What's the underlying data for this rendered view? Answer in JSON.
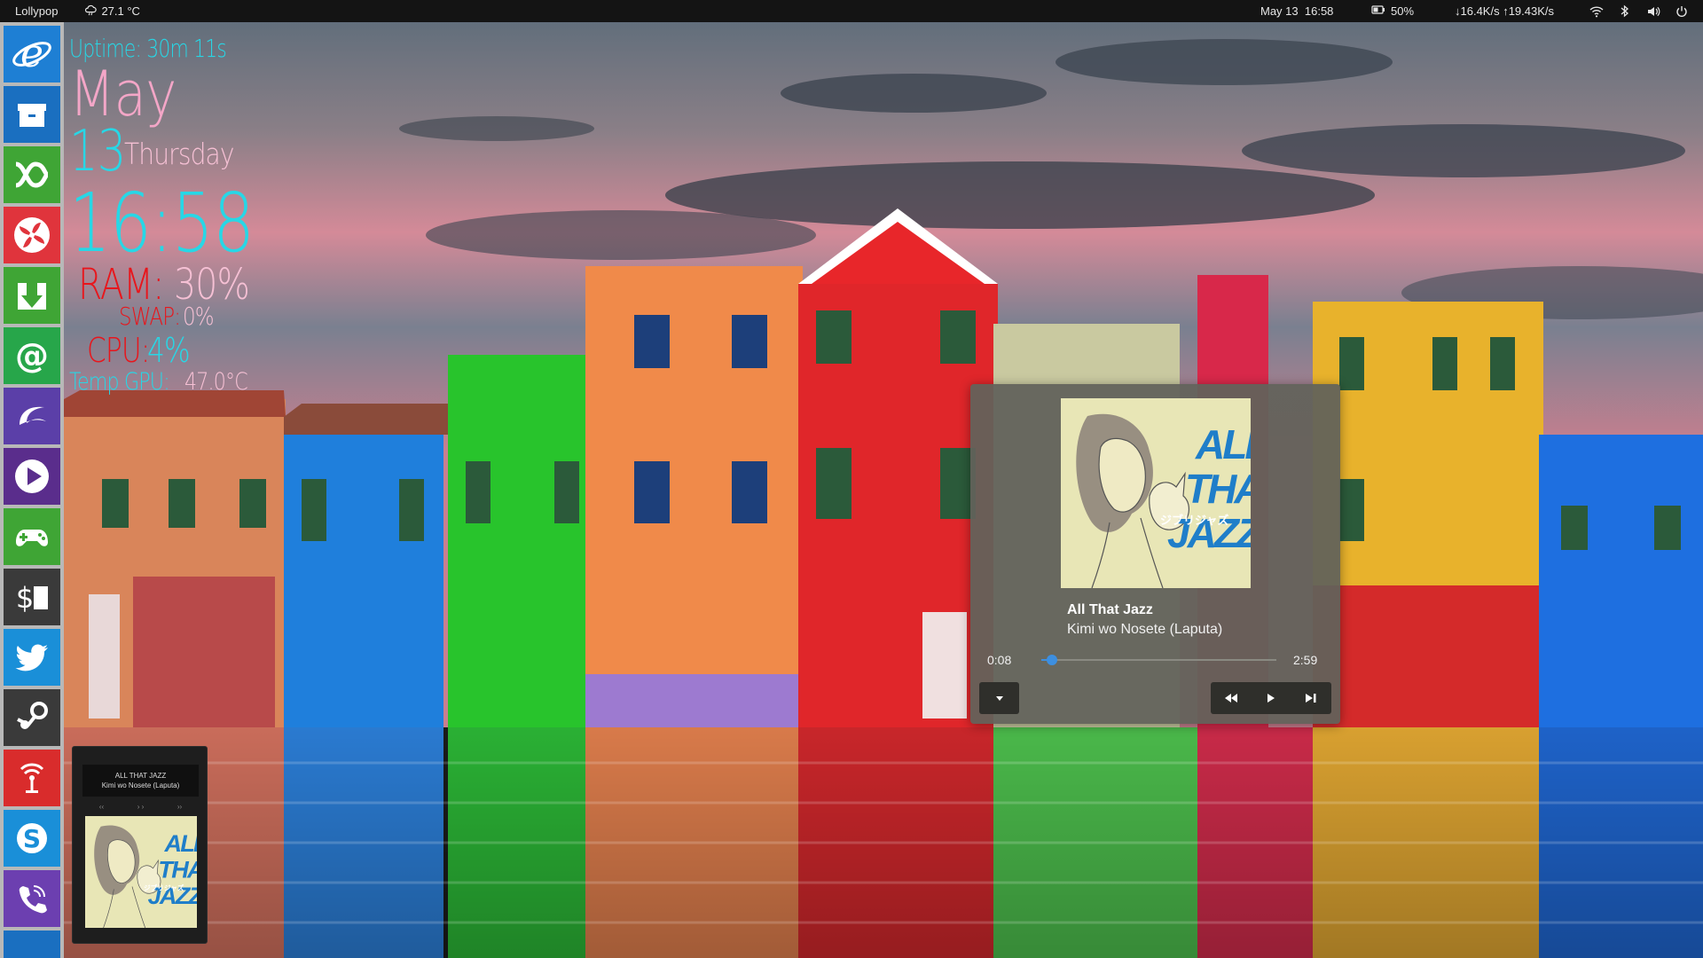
{
  "top_panel": {
    "distro": "Lollypop",
    "weather_icon": "cloud-weather-icon",
    "temperature": "27.1 °C",
    "date": "May 13",
    "time": "16:58",
    "battery_icon": "battery-icon",
    "battery": "50%",
    "network": "↓16.4K/s ↑19.43K/s",
    "tray_icons": [
      "wifi-icon",
      "bluetooth-icon",
      "volume-icon",
      "power-icon"
    ]
  },
  "dock": {
    "apps": [
      {
        "name": "internet-explorer",
        "icon": "internet-explorer-icon",
        "color": "#1e7fd4"
      },
      {
        "name": "archive-manager",
        "icon": "archive-icon",
        "color": "#1a6fc0"
      },
      {
        "name": "crossover",
        "icon": "crossover-icon",
        "color": "#3fa535"
      },
      {
        "name": "fan-control",
        "icon": "fan-icon",
        "color": "#e0343c"
      },
      {
        "name": "downloader",
        "icon": "download-icon",
        "color": "#3fa535"
      },
      {
        "name": "mail",
        "icon": "at-mail-icon",
        "color": "#27a64a"
      },
      {
        "name": "moon-app",
        "icon": "crescent-icon",
        "color": "#5b3fa8"
      },
      {
        "name": "media-player",
        "icon": "play-icon",
        "color": "#5a2d8c"
      },
      {
        "name": "games",
        "icon": "gamepad-icon",
        "color": "#3fa535"
      },
      {
        "name": "finance",
        "icon": "dollar-icon",
        "color": "#3a3a3a"
      },
      {
        "name": "twitter",
        "icon": "twitter-bird-icon",
        "color": "#1a8fd8"
      },
      {
        "name": "steam",
        "icon": "steam-icon",
        "color": "#3a3a3a"
      },
      {
        "name": "broadcast",
        "icon": "antenna-icon",
        "color": "#d92c2c"
      },
      {
        "name": "skype",
        "icon": "skype-icon",
        "color": "#1a8fd8"
      },
      {
        "name": "viber",
        "icon": "viber-phone-icon",
        "color": "#6c3fb0"
      }
    ]
  },
  "conky": {
    "uptime": "Uptime: 30m 11s",
    "month": "May",
    "day": "13",
    "weekday": "Thursday",
    "time": "16:58",
    "ram_label": "RAM:",
    "ram_value": "30%",
    "swap_label": "SWAP:",
    "swap_value": "0%",
    "cpu_label": "CPU:",
    "cpu_value": "4%",
    "temp_label": "Temp GPU:",
    "temp_value": "47.0°C"
  },
  "mini_player": {
    "title": "ALL THAT JAZZ",
    "subtitle": "Kimi wo Nosete (Laputa)",
    "controls": [
      "‹‹",
      "› ›",
      "››"
    ]
  },
  "player": {
    "title": "All That Jazz",
    "artist": "Kimi wo Nosete (Laputa)",
    "elapsed": "0:08",
    "total": "2:59",
    "progress": 0.044,
    "accent_color": "#3d8fe0"
  },
  "album_art": {
    "lines": [
      "ALL",
      "THAT",
      "JAZZ"
    ],
    "subtitle": "ジブリジャズ"
  }
}
